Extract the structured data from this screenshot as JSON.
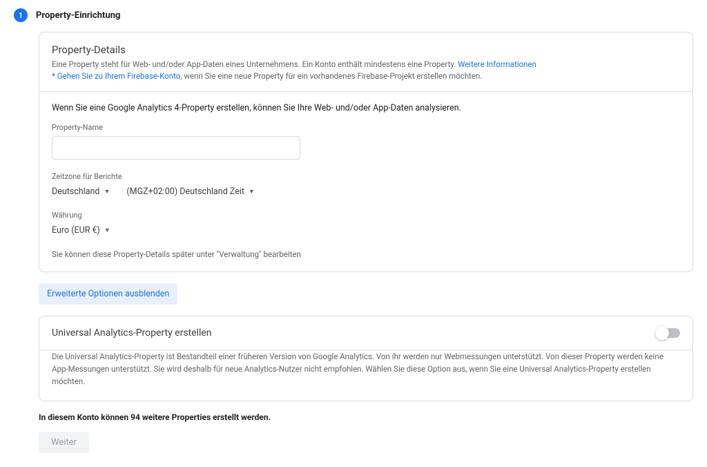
{
  "step": {
    "number": "1",
    "title": "Property-Einrichtung"
  },
  "details": {
    "heading": "Property-Details",
    "desc_a": "Eine Property steht für Web- und/oder App-Daten eines Unternehmens. Ein Konto enthält mindestens eine Property.",
    "more_link": "Weitere Informationen",
    "firebase_prefix": "* ",
    "firebase_link": "Gehen Sie zu Ihrem Firebase-Konto",
    "firebase_suffix": ", wenn Sie eine neue Property für ein vorhandenes Firebase-Projekt erstellen möchten."
  },
  "form": {
    "lead": "Wenn Sie eine Google Analytics 4-Property erstellen, können Sie Ihre Web- und/oder App-Daten analysieren.",
    "name_label": "Property-Name",
    "name_value": "",
    "tz_label": "Zeitzone für Berichte",
    "tz_country": "Deutschland",
    "tz_offset": "(MGZ+02:00) Deutschland Zeit",
    "currency_label": "Währung",
    "currency_value": "Euro (EUR €)",
    "hint": "Sie können diese Property-Details später unter \"Verwaltung\" bearbeiten"
  },
  "advanced": {
    "toggle_label": "Erweiterte Optionen ausblenden"
  },
  "ua": {
    "title": "Universal Analytics-Property erstellen",
    "body": "Die Universal Analytics-Property ist Bestandteil einer früheren Version von Google Analytics. Von ihr werden nur Webmessungen unterstützt. Von dieser Property werden keine App-Messungen unterstützt. Sie wird deshalb für neue Analytics-Nutzer nicht empfohlen. Wählen Sie diese Option aus, wenn Sie eine Universal Analytics-Property erstellen möchten."
  },
  "quota": "In diesem Konto können 94 weitere Properties erstellt werden.",
  "next_button": "Weiter"
}
